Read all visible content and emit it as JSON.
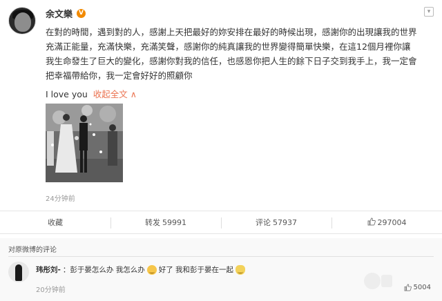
{
  "post": {
    "author": "余文樂",
    "verified_badge": "V",
    "lines": [
      "在對的時間，遇到對的人，感謝上天把最好的妳安排在最好的時候出現，感謝你的出現讓我的世界",
      "充滿正能量，充滿快樂，充滿笑聲，感謝你的純真讓我的世界變得簡單快樂，在這12個月裡你讓",
      "我生命發生了巨大的變化，感謝你對我的信任，也感恩你把人生的餘下日子交到我手上，我一定會",
      "把幸福帶給你，我一定會好好的照顧你"
    ],
    "love_text": "I love you",
    "collapse_label": "收起全文",
    "collapse_caret": "∧",
    "time": "24分钟前",
    "menu_icon": "chevron-down-icon"
  },
  "actions": {
    "favorite": "收藏",
    "repost_label": "转发",
    "repost_count": "59991",
    "comment_label": "评论",
    "comment_count": "57937",
    "like_count": "297004"
  },
  "comments": {
    "header": "对原微博的评论",
    "items": [
      {
        "user": "玮彤刘-",
        "text_a": "：彭于晏怎么办 我怎么办",
        "text_b": "好了 我和彭于晏在一起",
        "time": "20分钟前",
        "likes": "5004"
      }
    ]
  },
  "colors": {
    "accent": "#eb7350",
    "verified": "#f28a00"
  }
}
